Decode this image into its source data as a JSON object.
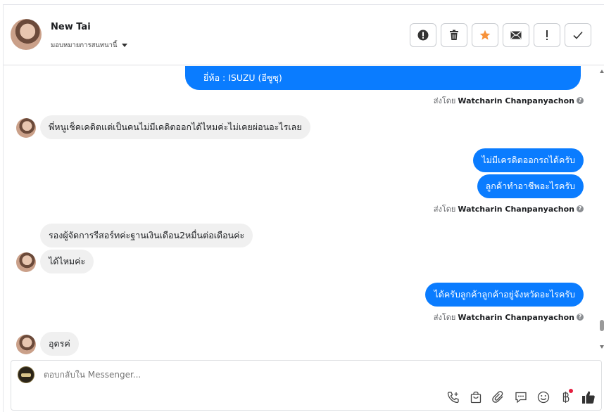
{
  "header": {
    "name": "New Tai",
    "assign_label": "มอบหมายการสนทนานี้",
    "actions": [
      {
        "icon": "alert-icon",
        "glyph": "!"
      },
      {
        "icon": "trash-icon",
        "glyph": "🗑"
      },
      {
        "icon": "star-icon",
        "glyph": "★"
      },
      {
        "icon": "mail-icon",
        "glyph": "✉"
      },
      {
        "icon": "exclamation-icon",
        "glyph": "!"
      },
      {
        "icon": "check-icon",
        "glyph": "✓"
      }
    ]
  },
  "messages": {
    "m1": "ยี่ห้อ : ISUZU (อีซูซุ)",
    "m2": "พี่หนูเช็คเคดิตแต่เป็นคนไม่มีเคดิตออกได้ไหมค่ะไม่เคยผ่อนอะไรเลย",
    "m3": "ไม่มีเครดิตออกรถได้ครับ",
    "m4": "ลูกค้าทำอาชีพอะไรครับ",
    "m5": "รองผู้จัดการรีสอร์ทค่ะฐานเงินเดือน2หมื่นต่อเดือนค่ะ",
    "m6": "ได้ไหมค่ะ",
    "m7": "ได้ครับลูกค้าลูกค้าอยู่จังหวัดอะไรครับ",
    "m8": "อุดรค่"
  },
  "sent_by": {
    "prefix": "ส่งโดย",
    "agent": "Watcharin Chanpanyachon",
    "help_glyph": "?"
  },
  "composer": {
    "placeholder": "ตอบกลับใน Messenger...",
    "tools": [
      "phone-plus-icon",
      "shopping-bag-icon",
      "paperclip-icon",
      "chat-bubble-icon",
      "emoji-icon",
      "baht-icon",
      "thumbs-up-icon"
    ]
  },
  "colors": {
    "outgoing": "#0a7cff",
    "incoming": "#f0f0f0",
    "star": "#f7923a"
  }
}
